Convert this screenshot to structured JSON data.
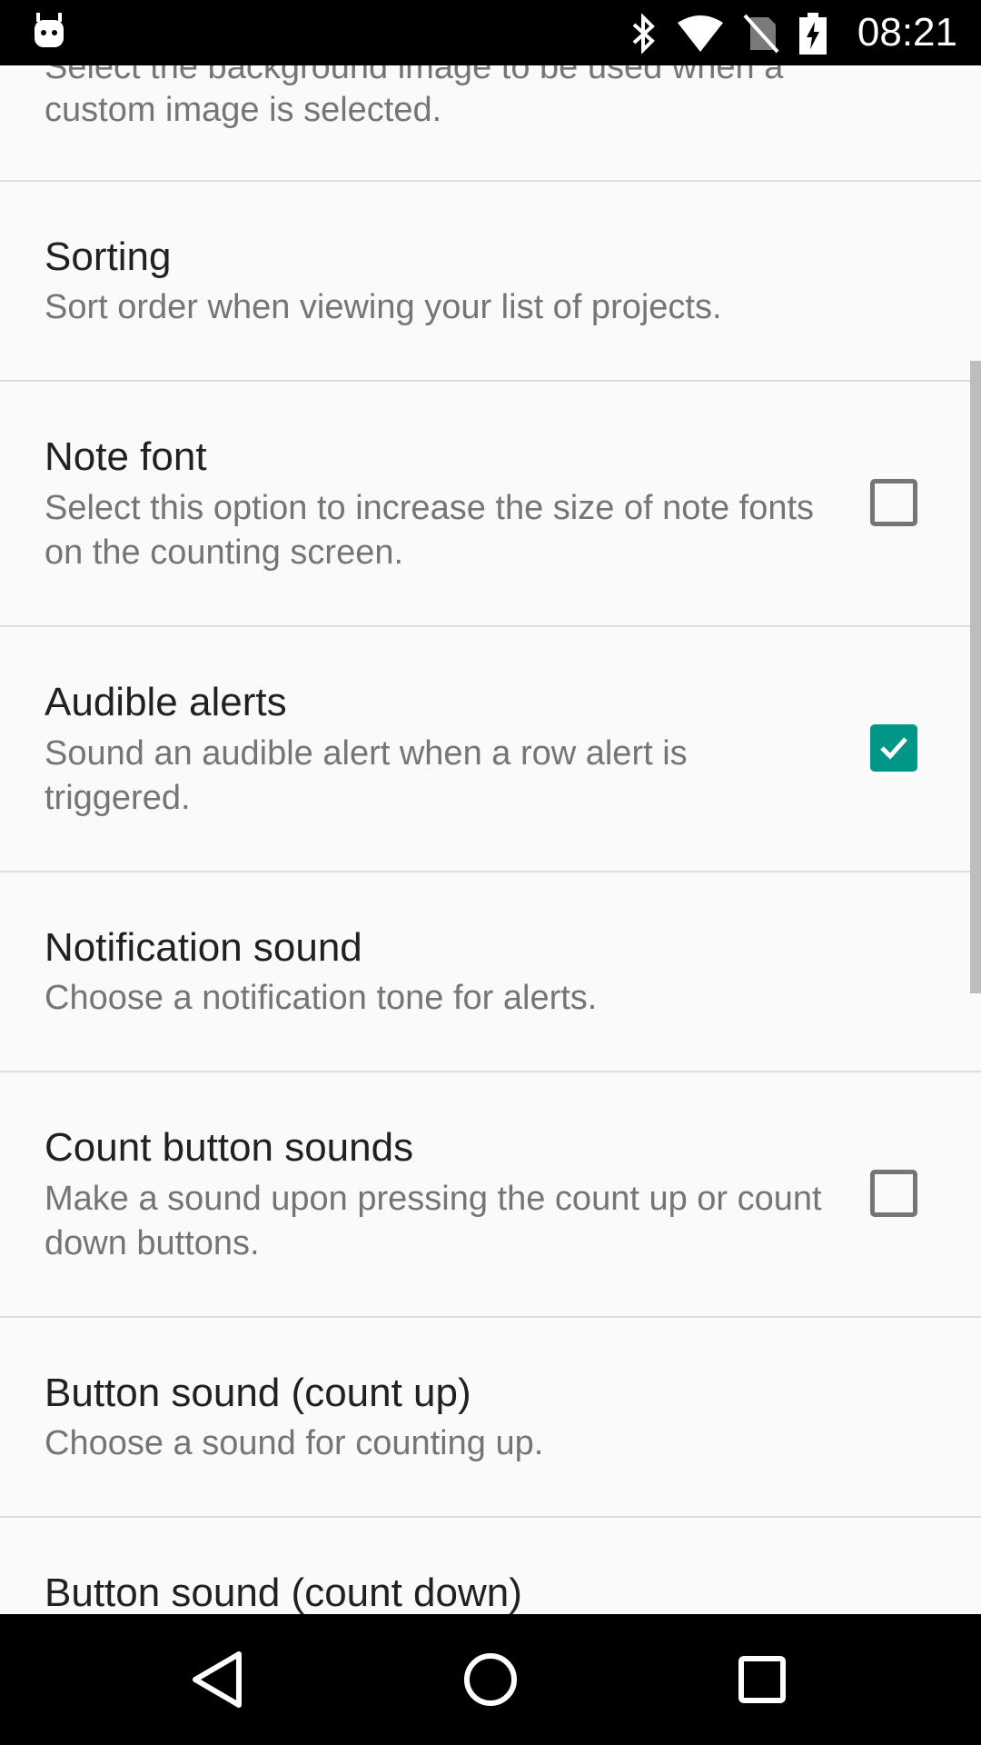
{
  "status_bar": {
    "time": "08:21",
    "icons": [
      "android-robot-icon",
      "bluetooth-icon",
      "wifi-icon",
      "no-sim-icon",
      "battery-charging-icon"
    ]
  },
  "settings": {
    "partial_summary_top": "Select the background image to be used when a",
    "partial_summary_bottom": "custom image is selected.",
    "items": [
      {
        "title": "Sorting",
        "summary": "Sort order when viewing your list of projects."
      },
      {
        "title": "Note font",
        "summary": "Select this option to increase the size of note fonts on the counting screen.",
        "checkbox": false
      },
      {
        "title": "Audible alerts",
        "summary": "Sound an audible alert when a row alert is triggered.",
        "checkbox": true
      },
      {
        "title": "Notification sound",
        "summary": "Choose a notification tone for alerts."
      },
      {
        "title": "Count button sounds",
        "summary": "Make a sound upon pressing the count up or count down buttons.",
        "checkbox": false
      },
      {
        "title": "Button sound (count up)",
        "summary": "Choose a sound for counting up."
      },
      {
        "title": "Button sound (count down)"
      }
    ]
  },
  "colors": {
    "accent": "#009688",
    "background": "#fafafa",
    "title_text": "#212121",
    "summary_text": "#757575"
  },
  "nav_bar": {
    "icons": [
      "back-icon",
      "home-icon",
      "recents-icon"
    ]
  }
}
